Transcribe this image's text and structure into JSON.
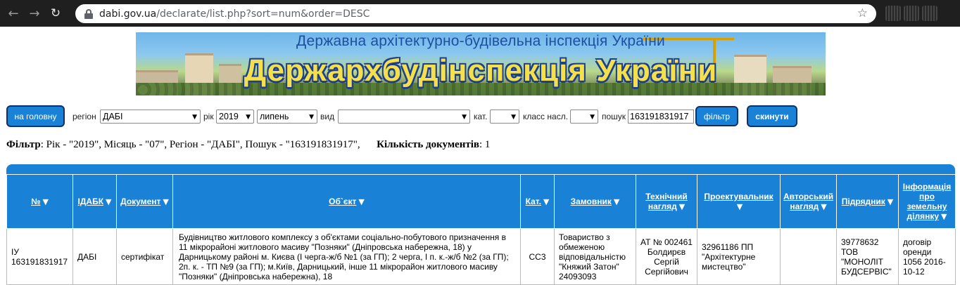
{
  "browser": {
    "url_host": "dabi.gov.ua",
    "url_path": "/declarate/list.php?sort=num&order=DESC",
    "back_icon": "arrow-left-icon",
    "forward_icon": "arrow-right-icon",
    "reload_icon": "reload-icon",
    "star_icon": "star-icon"
  },
  "banner": {
    "top_text": "Державна архітектурно-будівельна інспекція України",
    "main_text": "Держархбудінспекція України"
  },
  "filter": {
    "home_button": "на головну",
    "region_label": "регіон",
    "region_value": "ДАБІ",
    "year_label": "рік",
    "year_value": "2019",
    "month_value": "липень",
    "type_label": "вид",
    "type_value": "",
    "cat_label": "кат.",
    "cat_value": "",
    "class_label": "класс насл.",
    "class_value": "",
    "search_label": "пошук",
    "search_value": "163191831917",
    "filter_button": "фільтр",
    "reset_button": "скинути"
  },
  "summary": {
    "filter_label": "Фільтр",
    "filter_text": ": Рік - \"2019\", Місяць - \"07\", Регіон - \"ДАБІ\", Пошук - \"163191831917\",",
    "count_label": "Кількість документів",
    "count_value": ": 1"
  },
  "table": {
    "headers": [
      "№",
      "ІДАБК",
      "Документ",
      "Об`єкт",
      "Кат.",
      "Замовник",
      "Технічний нагляд",
      "Проектувальник",
      "Авторський нагляд",
      "Підрядник",
      "Інформація про земельну ділянку"
    ],
    "rows": [
      [
        "ІУ 163191831917",
        "ДАБІ",
        "сертифікат",
        "Будівництво житлового комплексу з об'єктами соціально-побутового призначення в 11 мікрорайоні житлового масиву \"Позняки\" (Дніпровська набережна, 18) у Дарницькому районі м. Києва (І черга-ж/б №1 (за ГП); 2 черга, І п. к.-ж/б №2 (за ГП); 2п. к. - ТП №9 (за ГП); м.Київ, Дарницький, інше 11 мікрорайон житлового масиву \"Позняки\" (Дніпровська набережна), 18",
        "СС3",
        "Товариство з обмеженою відповідальністю \"Княжий Затон\" 24093093",
        "АТ № 002461 Болдирєв Сергій Сергійович",
        "32961186 ПП \"Архітектурне мистецтво\"",
        "",
        "39778632 ТОВ \"МОНОЛІТ БУДСЕРВІС\"",
        "договір оренди 1056 2016-10-12"
      ]
    ]
  },
  "colors": {
    "accent": "#1a82d6",
    "button_border": "#0d2f6a",
    "banner_title": "#f4e04a"
  }
}
